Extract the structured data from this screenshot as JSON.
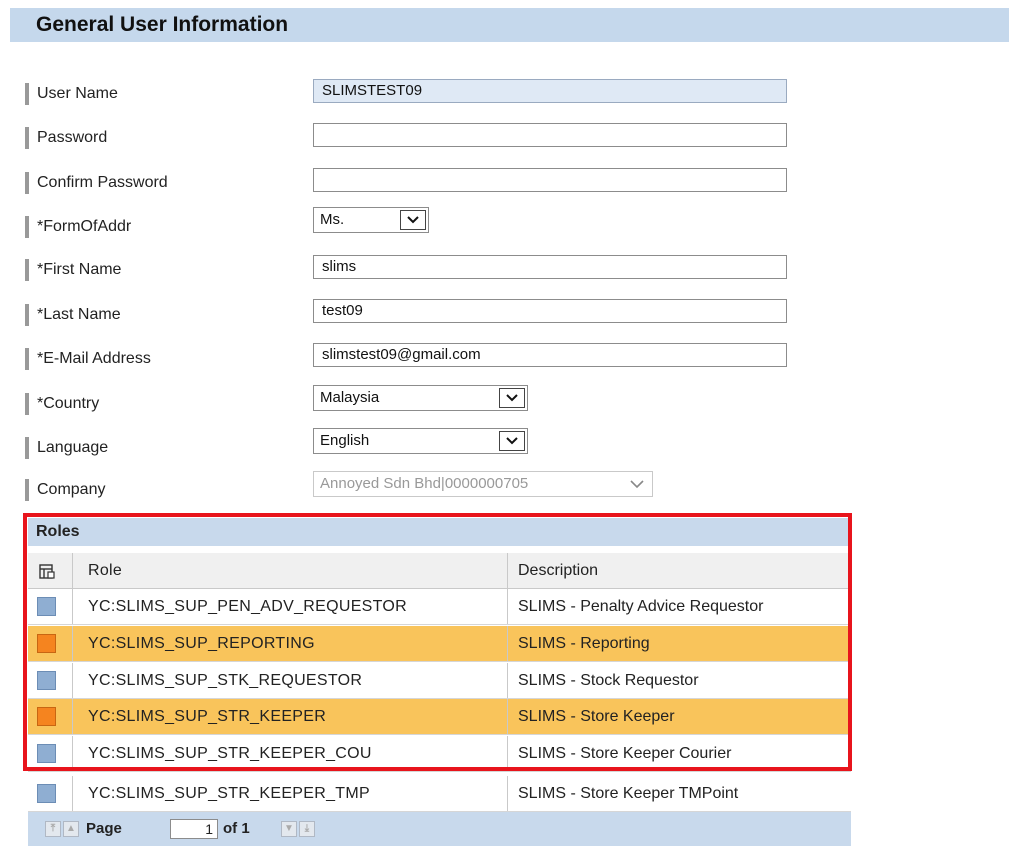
{
  "header": {
    "title": "General User Information"
  },
  "form": {
    "user_name": {
      "label": "User Name",
      "value": "SLIMSTEST09"
    },
    "password": {
      "label": "Password",
      "value": ""
    },
    "confirm_password": {
      "label": "Confirm Password",
      "value": ""
    },
    "form_of_addr": {
      "label": "*FormOfAddr",
      "value": "Ms."
    },
    "first_name": {
      "label": "*First Name",
      "value": "slims"
    },
    "last_name": {
      "label": "*Last Name",
      "value": "test09"
    },
    "email": {
      "label": "*E-Mail Address",
      "value": "slimstest09@gmail.com"
    },
    "country": {
      "label": "*Country",
      "value": "Malaysia"
    },
    "language": {
      "label": "Language",
      "value": "English"
    },
    "company": {
      "label": "Company",
      "value": "Annoyed Sdn Bhd|0000000705"
    }
  },
  "roles": {
    "title": "Roles",
    "columns": {
      "role": "Role",
      "description": "Description"
    },
    "rows": [
      {
        "role": "YC:SLIMS_SUP_PEN_ADV_REQUESTOR",
        "description": "SLIMS - Penalty Advice Requestor",
        "selected": false
      },
      {
        "role": "YC:SLIMS_SUP_REPORTING",
        "description": "SLIMS - Reporting",
        "selected": true
      },
      {
        "role": "YC:SLIMS_SUP_STK_REQUESTOR",
        "description": "SLIMS - Stock Requestor",
        "selected": false
      },
      {
        "role": "YC:SLIMS_SUP_STR_KEEPER",
        "description": "SLIMS - Store Keeper",
        "selected": true
      },
      {
        "role": "YC:SLIMS_SUP_STR_KEEPER_COU",
        "description": "SLIMS - Store Keeper Courier",
        "selected": false
      },
      {
        "role": "YC:SLIMS_SUP_STR_KEEPER_TMP",
        "description": "SLIMS - Store Keeper TMPoint",
        "selected": false
      }
    ],
    "pager": {
      "page_label": "Page",
      "page_value": "1",
      "of_label": "of 1"
    }
  },
  "colors": {
    "header_bg": "#c5d8ec",
    "selected_row": "#f9c45b",
    "selected_check": "#f5841f",
    "unselected_check": "#8faed2",
    "highlight_border": "#e8141c"
  },
  "icons": [
    "chevron-down-icon",
    "table-settings-icon",
    "first-page-icon",
    "prev-page-icon",
    "next-page-icon",
    "last-page-icon"
  ]
}
